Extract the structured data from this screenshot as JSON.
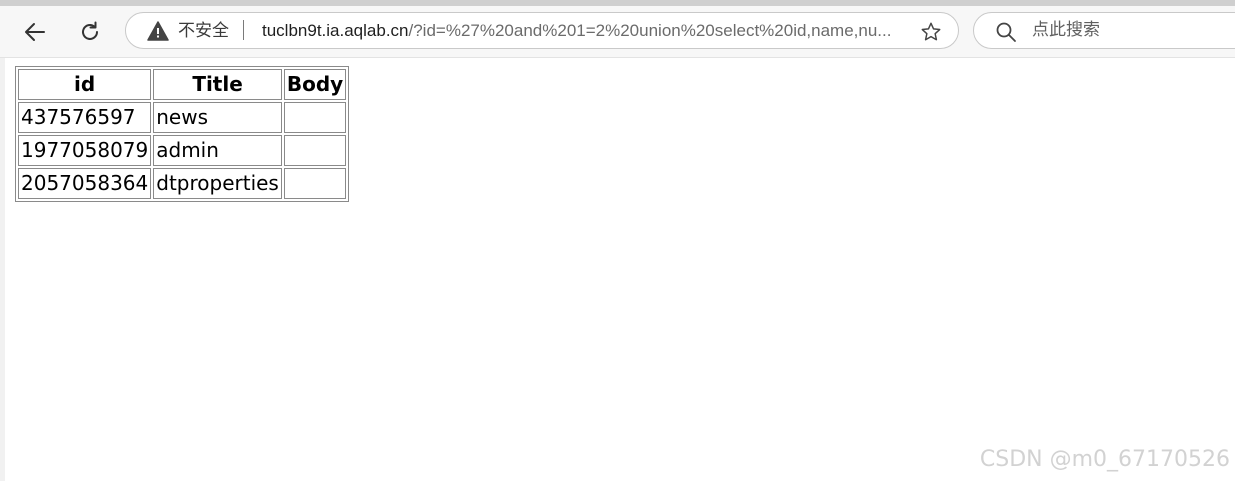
{
  "browser": {
    "security_label": "不安全",
    "url_host": "tuclbn9t.ia.aqlab.cn",
    "url_rest": "/?id=%27%20and%201=2%20union%20select%20id,name,nu...",
    "search_placeholder": "点此搜索",
    "icons": [
      "back-arrow-icon",
      "reload-icon",
      "warning-triangle-icon",
      "star-icon",
      "search-icon"
    ]
  },
  "table": {
    "headers": [
      "id",
      "Title",
      "Body"
    ],
    "rows": [
      [
        "437576597",
        "news",
        ""
      ],
      [
        "1977058079",
        "admin",
        ""
      ],
      [
        "2057058364",
        "dtproperties",
        ""
      ]
    ]
  },
  "watermark": "CSDN @m0_67170526"
}
